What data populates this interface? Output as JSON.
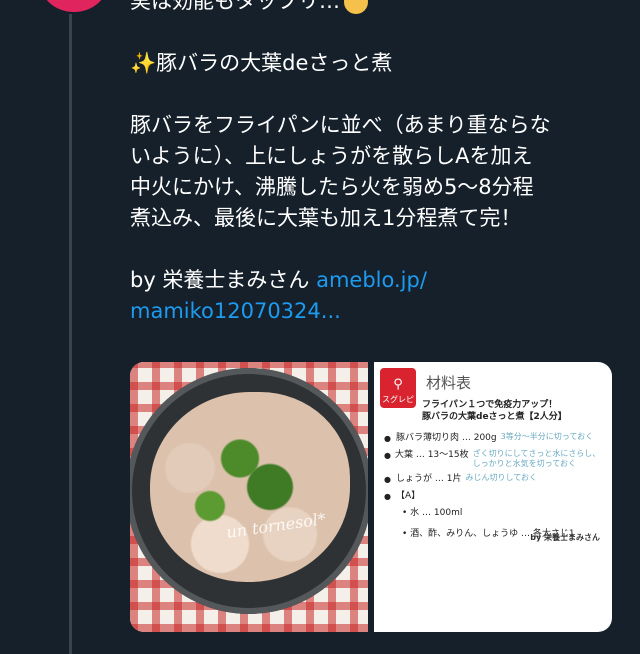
{
  "tweet": {
    "line_top": "実は効能もタップリ…",
    "sparkle": "✨",
    "recipe_title": "豚バラの大葉deさっと煮",
    "body_lines": [
      "豚バラをフライパンに並べ（あまり重ならな",
      "いように）、上にしょうがを散らしAを加え",
      "中火にかけ、沸騰したら火を弱め5〜8分程",
      "煮込み、最後に大葉も加え1分程煮て完！"
    ],
    "credit_prefix": "by 栄養士まみさん ",
    "link_line1": "ameblo.jp/",
    "link_line2": "mamiko12070324..."
  },
  "media": {
    "watermark": "un tornesol*",
    "recipe_card": {
      "brand": "スグレピ",
      "title": "材料表",
      "subtitle_line1": "フライパン１つで免疫力アップ！",
      "subtitle_line2": "豚バラの大葉deさっと煮【2人分】",
      "ingredients": [
        {
          "name": "豚バラ薄切り肉 … 200g",
          "note": "3等分〜半分に切っておく"
        },
        {
          "name": "大葉 … 13〜15枚",
          "note": "ざく切りにしてさっと水にさらし、しっかりと水気を切っておく"
        },
        {
          "name": "しょうが … 1片",
          "note": "みじん切りしておく"
        },
        {
          "name": "【A】",
          "note": ""
        }
      ],
      "sub_items": [
        "水 … 100ml",
        "酒、酢、みりん、しょうゆ … 各大さじ1"
      ],
      "credit": "by 栄養士まみさん"
    }
  },
  "colors": {
    "background": "#15202b",
    "link": "#1d9bf0",
    "thread_line": "#38444d",
    "badge_red": "#d9232e",
    "note_blue": "#6aaac2"
  }
}
